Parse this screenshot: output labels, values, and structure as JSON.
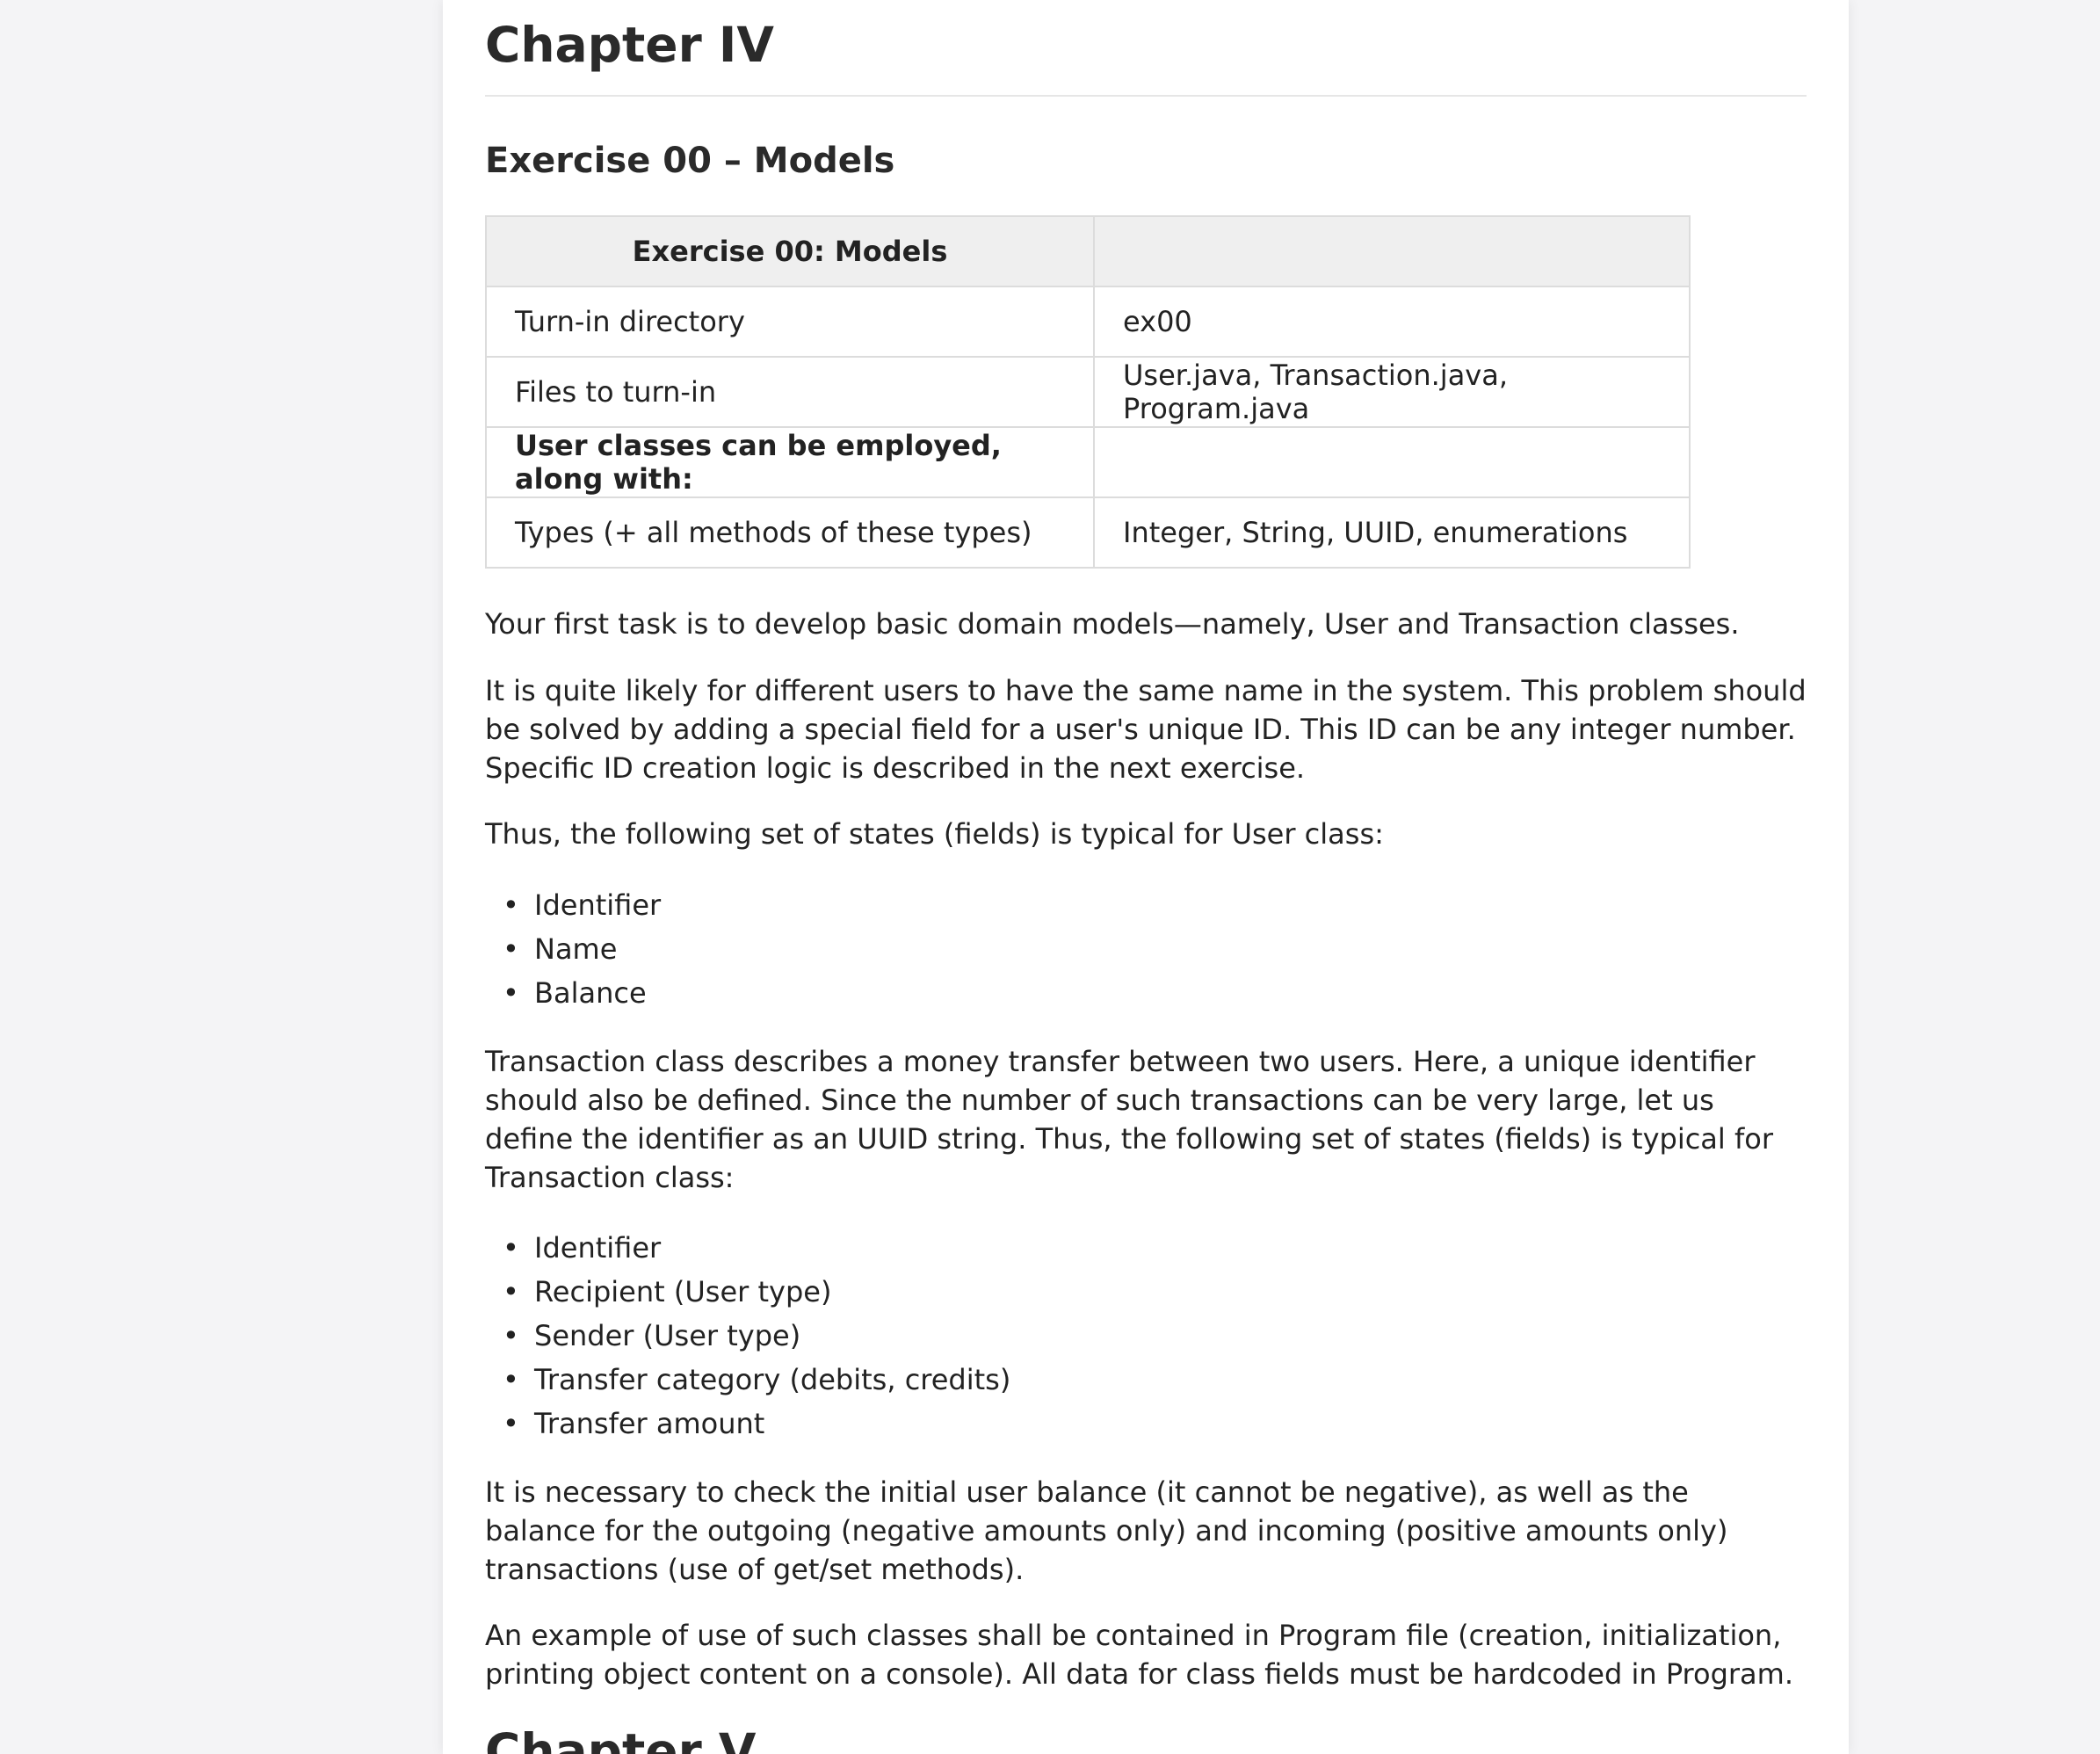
{
  "chapter_title": "Chapter IV",
  "exercise_heading": "Exercise 00 – Models",
  "table": {
    "header": [
      "Exercise 00: Models",
      ""
    ],
    "rows": [
      [
        "Turn-in directory",
        "ex00"
      ],
      [
        "Files to turn-in",
        "User.java, Transaction.java, Program.java"
      ],
      [
        "User classes can be employed, along with:",
        ""
      ],
      [
        "Types (+ all methods of these types)",
        "Integer, String, UUID, enumerations"
      ]
    ]
  },
  "paragraphs": {
    "p1": "Your first task is to develop basic domain models—namely, User and Transaction classes.",
    "p2": "It is quite likely for different users to have the same name in the system. This problem should be solved by adding a special field for a user's unique ID. This ID can be any integer number. Specific ID creation logic is described in the next exercise.",
    "p3": "Thus, the following set of states (fields) is typical for User class:",
    "p4": "Transaction class describes a money transfer between two users. Here, a unique identifier should also be defined. Since the number of such transactions can be very large, let us define the identifier as an UUID string. Thus, the following set of states (fields) is typical for Transaction class:",
    "p5": "It is necessary to check the initial user balance (it cannot be negative), as well as the balance for the outgoing (negative amounts only) and incoming (positive amounts only) transactions (use of get/set methods).",
    "p6": "An example of use of such classes shall be contained in Program file (creation, initialization, printing object content on a console). All data for class fields must be hardcoded in Program."
  },
  "user_fields": [
    "Identifier",
    "Name",
    "Balance"
  ],
  "transaction_fields": [
    "Identifier",
    "Recipient (User type)",
    "Sender (User type)",
    "Transfer category (debits, credits)",
    "Transfer amount"
  ],
  "bullet_glyph": "•",
  "next_chapter_title": "Chapter V"
}
